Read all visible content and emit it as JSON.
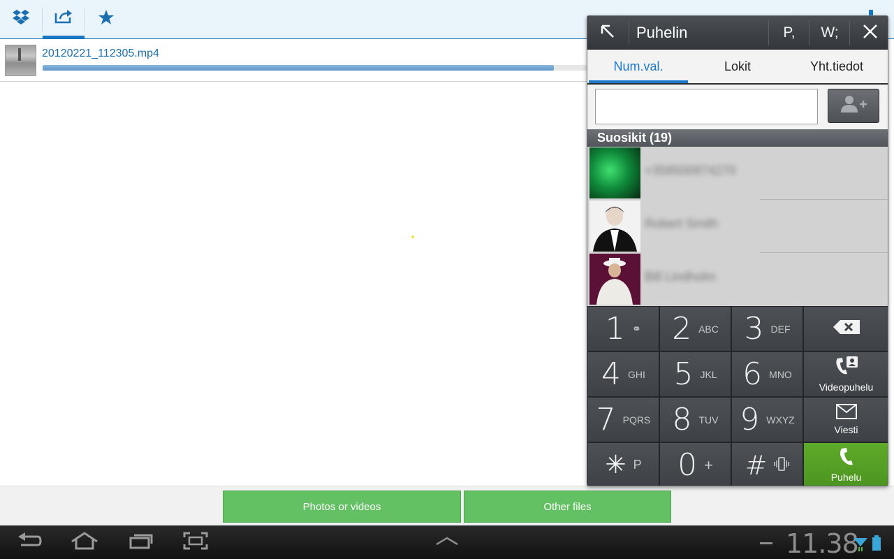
{
  "top_tabs": [
    {
      "name": "dropbox-icon",
      "selected": false
    },
    {
      "name": "upload-icon",
      "selected": true
    },
    {
      "name": "star-icon",
      "selected": false
    }
  ],
  "upload": {
    "filename": "20120221_112305.mp4",
    "progress": 0.94
  },
  "actions": {
    "photos_label": "Photos or videos",
    "other_label": "Other files"
  },
  "status": {
    "time": "11.38"
  },
  "phone": {
    "title": "Puhelin",
    "shortcut_p": "P,",
    "shortcut_w": "W;",
    "tabs": [
      {
        "label": "Num.val.",
        "selected": true
      },
      {
        "label": "Lokit",
        "selected": false
      },
      {
        "label": "Yht.tiedot",
        "selected": false
      }
    ],
    "input_value": "",
    "favorites_header": "Suosikit (19)",
    "favorites": [
      {
        "name": "+358500974270"
      },
      {
        "name": "Robert Smith"
      },
      {
        "name": "Bill Lindholm"
      }
    ],
    "keys": [
      {
        "digit": "1",
        "letters": "⚭"
      },
      {
        "digit": "2",
        "letters": "ABC"
      },
      {
        "digit": "3",
        "letters": "DEF"
      },
      {
        "digit": "4",
        "letters": "GHI"
      },
      {
        "digit": "5",
        "letters": "JKL"
      },
      {
        "digit": "6",
        "letters": "MNO"
      },
      {
        "digit": "7",
        "letters": "PQRS"
      },
      {
        "digit": "8",
        "letters": "TUV"
      },
      {
        "digit": "9",
        "letters": "WXYZ"
      },
      {
        "digit": "✳",
        "letters": "P"
      },
      {
        "digit": "0",
        "letters": "+"
      },
      {
        "digit": "#",
        "letters": ""
      }
    ],
    "side_keys": {
      "videocall_label": "Videopuhelu",
      "message_label": "Viesti",
      "call_label": "Puhelu"
    }
  }
}
